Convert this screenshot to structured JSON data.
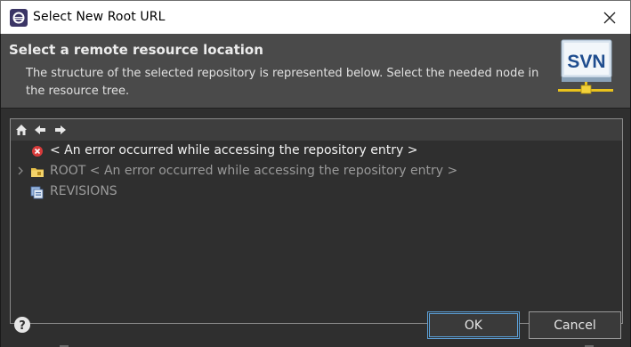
{
  "window": {
    "title": "Select New Root URL",
    "app_icon": "eclipse-icon",
    "close_icon": "close-icon"
  },
  "header": {
    "title": "Select a remote resource location",
    "description": "The structure of the selected repository is represented below. Select the needed node in the resource tree.",
    "logo_text": "SVN"
  },
  "toolbar": {
    "items": [
      {
        "icon": "home-icon",
        "name": "home-button"
      },
      {
        "icon": "back-arrow-icon",
        "name": "back-button"
      },
      {
        "icon": "forward-arrow-icon",
        "name": "forward-button"
      }
    ]
  },
  "tree": {
    "items": [
      {
        "label": "< An error occurred while accessing the repository entry >",
        "icon": "error-icon",
        "expandable": false,
        "dimmed": false
      },
      {
        "label": "ROOT < An error occurred while accessing the repository entry >",
        "icon": "folder-icon",
        "expandable": true,
        "dimmed": true
      },
      {
        "label": "REVISIONS",
        "icon": "revisions-icon",
        "expandable": false,
        "dimmed": true
      }
    ]
  },
  "footer": {
    "help_icon": "help-icon",
    "ok_label": "OK",
    "cancel_label": "Cancel"
  },
  "colors": {
    "accent": "#5c9fd6",
    "error": "#d83b3b",
    "folder": "#e8c14a"
  }
}
